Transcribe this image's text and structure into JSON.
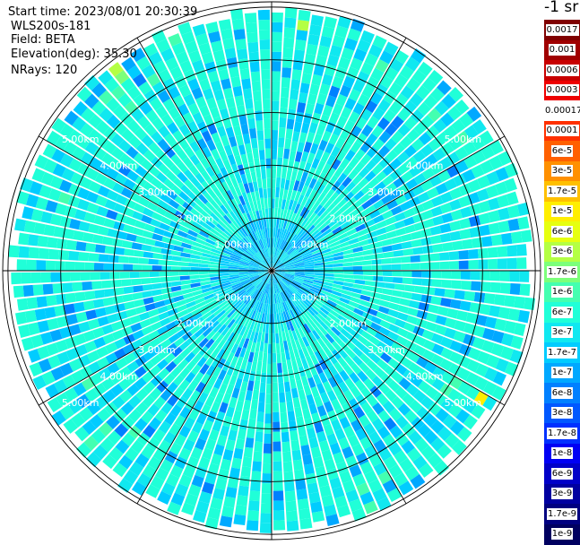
{
  "header": {
    "start_time": "Start time: 2023/08/01 20:30:39",
    "instrument": "WLS200s-181",
    "field": "Field: BETA",
    "elevation": "Elevation(deg): 35.30",
    "nrays": "NRays: 120"
  },
  "colorbar": {
    "unit_label": "-1 sr",
    "levels": [
      {
        "label": "0.0017",
        "color": "#800000"
      },
      {
        "label": "0.001",
        "color": "#a00000"
      },
      {
        "label": "0.0006",
        "color": "#c80000"
      },
      {
        "label": "0.0003",
        "color": "#ee0000"
      },
      {
        "label": "0.00017",
        "color": "#ffffff"
      },
      {
        "label": "0.0001",
        "color": "#ff3000"
      },
      {
        "label": "6e-5",
        "color": "#ff6000"
      },
      {
        "label": "3e-5",
        "color": "#ff9000"
      },
      {
        "label": "1.7e-5",
        "color": "#ffc000"
      },
      {
        "label": "1e-5",
        "color": "#ffee00"
      },
      {
        "label": "6e-6",
        "color": "#e6ff10"
      },
      {
        "label": "3e-6",
        "color": "#b4ff44"
      },
      {
        "label": "1.7e-6",
        "color": "#7cff7a"
      },
      {
        "label": "1e-6",
        "color": "#44ffb0"
      },
      {
        "label": "6e-7",
        "color": "#20ffd8"
      },
      {
        "label": "3e-7",
        "color": "#10e8f0"
      },
      {
        "label": "1.7e-7",
        "color": "#00ccff"
      },
      {
        "label": "1e-7",
        "color": "#00a8ff"
      },
      {
        "label": "6e-8",
        "color": "#0080ff"
      },
      {
        "label": "3e-8",
        "color": "#0058ff"
      },
      {
        "label": "1.7e-8",
        "color": "#0030ff"
      },
      {
        "label": "1e-8",
        "color": "#0000f4"
      },
      {
        "label": "6e-9",
        "color": "#0000c8"
      },
      {
        "label": "3e-9",
        "color": "#0000a0"
      },
      {
        "label": "1.7e-9",
        "color": "#000080"
      },
      {
        "label": "1e-9",
        "color": "#000060"
      }
    ]
  },
  "chart_data": {
    "type": "heatmap",
    "projection": "polar (PPI)",
    "n_rays": 120,
    "range_ring_labels": [
      "1.00km",
      "2.00km",
      "3.00km",
      "4.00km",
      "5.00km"
    ],
    "range_rings_km": [
      1,
      2,
      3,
      4,
      5
    ],
    "max_range_km": 5.1,
    "spokes_every_deg": 30,
    "field": "BETA",
    "elevation_deg": 35.3,
    "dominant_value_range": [
      "1e-7",
      "3e-7"
    ],
    "grid": true
  }
}
